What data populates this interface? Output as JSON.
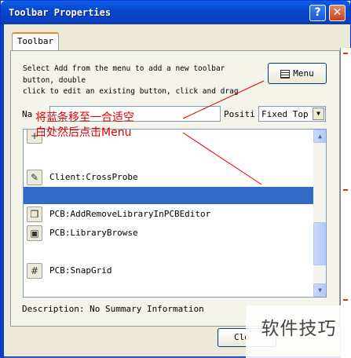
{
  "window": {
    "title": "Toolbar Properties",
    "help_glyph": "?",
    "close_glyph": "✕",
    "title_bar_color": "#0a4fd6"
  },
  "tabs": [
    {
      "label": "Toolbar"
    }
  ],
  "instructions": {
    "line1": "Select Add from the menu to add a new toolbar",
    "line2": "button, double",
    "line3": "click to edit an existing button, click and drag"
  },
  "menu_button": {
    "label": "Menu",
    "icon": "menu-icon"
  },
  "name_field": {
    "label": "Na",
    "value": ""
  },
  "position_field": {
    "label": "Positi",
    "value": "Fixed Top"
  },
  "command_list": {
    "items": [
      {
        "label": "",
        "icon": "plus-icon",
        "glyph": "+"
      },
      {
        "label": "Client:CrossProbe",
        "icon": "crossprobe-icon",
        "glyph": "✎"
      },
      {
        "label": "",
        "icon": "",
        "glyph": "",
        "selected": true
      },
      {
        "label": "PCB:AddRemoveLibraryInPCBEditor",
        "icon": "library-icon",
        "glyph": "❒"
      },
      {
        "label": "PCB:LibraryBrowse",
        "icon": "library-browse-icon",
        "glyph": "▣"
      },
      {
        "label": "PCB:SnapGrid",
        "icon": "grid-icon",
        "glyph": "#"
      }
    ],
    "selection_color": "#316ac5"
  },
  "description": "Description: No Summary Information",
  "close_button": {
    "label": "Clo"
  },
  "annotation": {
    "line1": "将蓝条移至一合适空",
    "line2": "白处然后点击Menu",
    "color": "#dd0000"
  },
  "watermark": {
    "text": "软件技巧"
  }
}
